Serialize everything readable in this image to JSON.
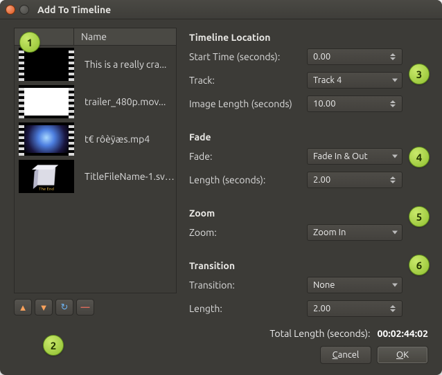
{
  "window": {
    "title": "Add To Timeline"
  },
  "list": {
    "header_name": "Name",
    "items": [
      {
        "label": "This is a really cra..."
      },
      {
        "label": "trailer_480p.mov..."
      },
      {
        "label": "t€ rôèÿæs.mp4"
      },
      {
        "label": "TitleFileName-1.svg..."
      }
    ]
  },
  "sections": {
    "timeline_location": {
      "title": "Timeline Location",
      "start_time_label": "Start Time (seconds):",
      "start_time_value": "0.00",
      "track_label": "Track:",
      "track_value": "Track 4",
      "image_length_label": "Image Length (seconds)",
      "image_length_value": "10.00"
    },
    "fade": {
      "title": "Fade",
      "fade_label": "Fade:",
      "fade_value": "Fade In & Out",
      "length_label": "Length (seconds):",
      "length_value": "2.00"
    },
    "zoom": {
      "title": "Zoom",
      "zoom_label": "Zoom:",
      "zoom_value": "Zoom In"
    },
    "transition": {
      "title": "Transition",
      "transition_label": "Transition:",
      "transition_value": "None",
      "length_label": "Length:",
      "length_value": "2.00"
    }
  },
  "footer": {
    "total_label": "Total Length (seconds):",
    "total_value": "00:02:44:02",
    "cancel": "Cancel",
    "ok": "OK"
  },
  "badges": [
    "1",
    "2",
    "3",
    "4",
    "5",
    "6"
  ]
}
